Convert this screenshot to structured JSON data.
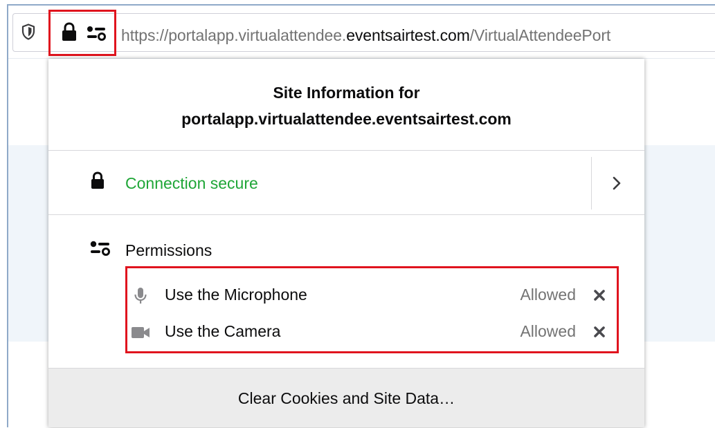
{
  "browser": {
    "url_prefix": "https://portalapp.virtualattendee.",
    "url_host": "eventsairtest.com",
    "url_suffix": "/VirtualAttendeePort",
    "icons": {
      "shield": "shield-icon",
      "lock": "lock-icon",
      "permissions": "permissions-icon"
    }
  },
  "panel": {
    "title": "Site Information for",
    "host": "portalapp.virtualattendee.eventsairtest.com",
    "connection": {
      "label": "Connection secure",
      "color": "#1fa637"
    },
    "permissions": {
      "heading": "Permissions",
      "items": [
        {
          "name": "Use the Microphone",
          "state": "Allowed",
          "icon": "microphone-icon"
        },
        {
          "name": "Use the Camera",
          "state": "Allowed",
          "icon": "camera-icon"
        }
      ]
    },
    "footer_button": "Clear Cookies and Site Data…"
  },
  "colors": {
    "highlight": "#e0141e",
    "muted_text": "#737373"
  }
}
